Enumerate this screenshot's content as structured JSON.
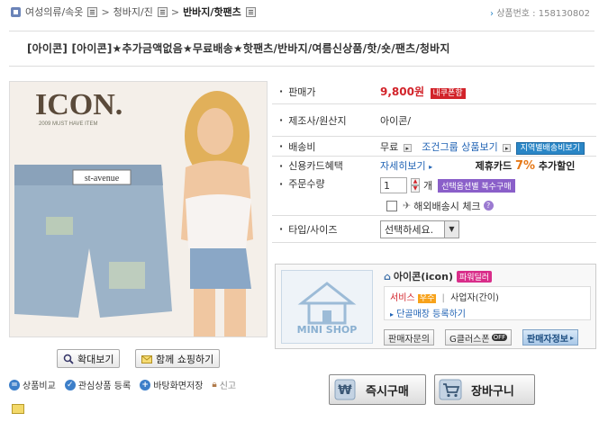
{
  "breadcrumb": {
    "items": [
      "여성의류/속옷",
      "청바지/진",
      "반바지/핫팬츠"
    ]
  },
  "product_no": {
    "label": "상품번호 :",
    "value": "158130802"
  },
  "title": "[아이콘] [아이콘]★추가금액없음★무료배송★핫팬츠/반바지/여름신상품/핫/숏/팬츠/청바지",
  "image": {
    "logo": "ICON.",
    "logo_sub": "2009 MUST HAVE ITEM",
    "label": "st-avenue"
  },
  "image_buttons": {
    "zoom": "확대보기",
    "shop_together": "함께 쇼핑하기"
  },
  "tools": {
    "compare": "상품비교",
    "interest": "관심상품 등록",
    "desktop": "바탕화면저장",
    "report": "신고"
  },
  "info": {
    "price_label": "판매가",
    "price_value": "9,800원",
    "coupon_badge": "내쿠폰함",
    "maker_label": "제조사/원산지",
    "maker_value": "아이콘/",
    "shipping_label": "배송비",
    "shipping_value": "무료",
    "shipping_condition": "조건그룹 상품보기",
    "shipping_region": "지역별배송비보기",
    "card_label": "신용카드혜택",
    "card_detail": "자세히보기",
    "card_promo_prefix": "제휴카드",
    "card_promo_pct": "7%",
    "card_promo_suffix": "추가할인",
    "qty_label": "주문수량",
    "qty_value": "1",
    "qty_unit": "개",
    "qty_multi": "선택옵션별 복수구매",
    "overseas": "해외배송시 체크",
    "type_label": "타입/사이즈",
    "type_select": "선택하세요."
  },
  "seller": {
    "mini_shop": "MINI SHOP",
    "name": "아이콘(icon)",
    "grade": "파워딜러",
    "service_label": "서비스",
    "service_grade": "우수",
    "biz_type": "사업자(간이)",
    "shop_register": "단골매장 등록하기",
    "btn_inquiry": "판매자문의",
    "btn_gclub": "G클러스폰",
    "btn_gclub_tag": "OFF",
    "btn_info": "판매자정보"
  },
  "actions": {
    "buy_now": "즉시구매",
    "cart": "장바구니"
  },
  "colors": {
    "price_red": "#d2232a",
    "link_blue": "#2264b5",
    "badge_blue": "#2a86c6",
    "badge_purple": "#8a5fc9",
    "promo_orange": "#e67817"
  }
}
